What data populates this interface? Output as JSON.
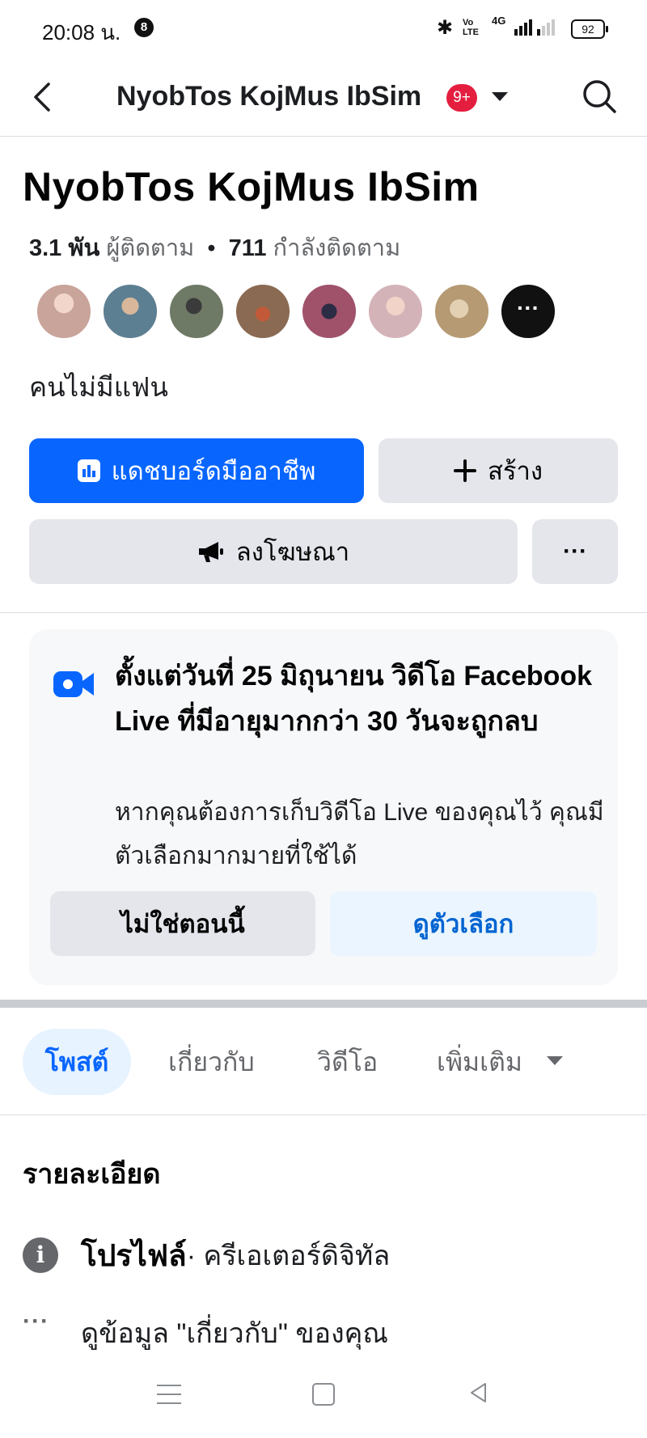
{
  "status_bar": {
    "time": "20:08 น.",
    "notification_count": "8",
    "network_top": "Vo",
    "network_bottom": "LTE",
    "network_type": "4G",
    "battery": "92"
  },
  "header": {
    "title": "NyobTos KojMus IbSim",
    "badge": "9+"
  },
  "profile": {
    "name": "NyobTos KojMus IbSim",
    "followers_count": "3.1 พัน",
    "followers_label": "ผู้ติดตาม",
    "following_count": "711",
    "following_label": "กำลังติดตาม",
    "bio": "คนไม่มีแฟน",
    "avatar_colors": [
      "#c9a49a",
      "#5d7f92",
      "#6f7a66",
      "#8a6a52",
      "#a0526a",
      "#d4b3b8",
      "#b69a74"
    ],
    "more_label": "···"
  },
  "actions": {
    "dashboard": "แดชบอร์ดมืออาชีพ",
    "create": "สร้าง",
    "advertise": "ลงโฆษณา",
    "more": "···"
  },
  "notice": {
    "title": "ตั้งแต่วันที่ 25 มิถุนายน วิดีโอ Facebook Live ที่มีอายุมากกว่า 30 วันจะถูกลบ",
    "description": "หากคุณต้องการเก็บวิดีโอ Live ของคุณไว้ คุณมีตัวเลือกมากมายที่ใช้ได้",
    "dismiss": "ไม่ใช่ตอนนี้",
    "view_options": "ดูตัวเลือก",
    "accent": "#0866ff"
  },
  "tabs": {
    "posts": "โพสต์",
    "about": "เกี่ยวกับ",
    "videos": "วิดีโอ",
    "more": "เพิ่มเติม"
  },
  "details": {
    "heading": "รายละเอียด",
    "profile_label": "โปรไฟล์",
    "profile_type": " · ครีเอเตอร์ดิจิทัล",
    "about_link": "ดูข้อมูล \"เกี่ยวกับ\" ของคุณ"
  }
}
